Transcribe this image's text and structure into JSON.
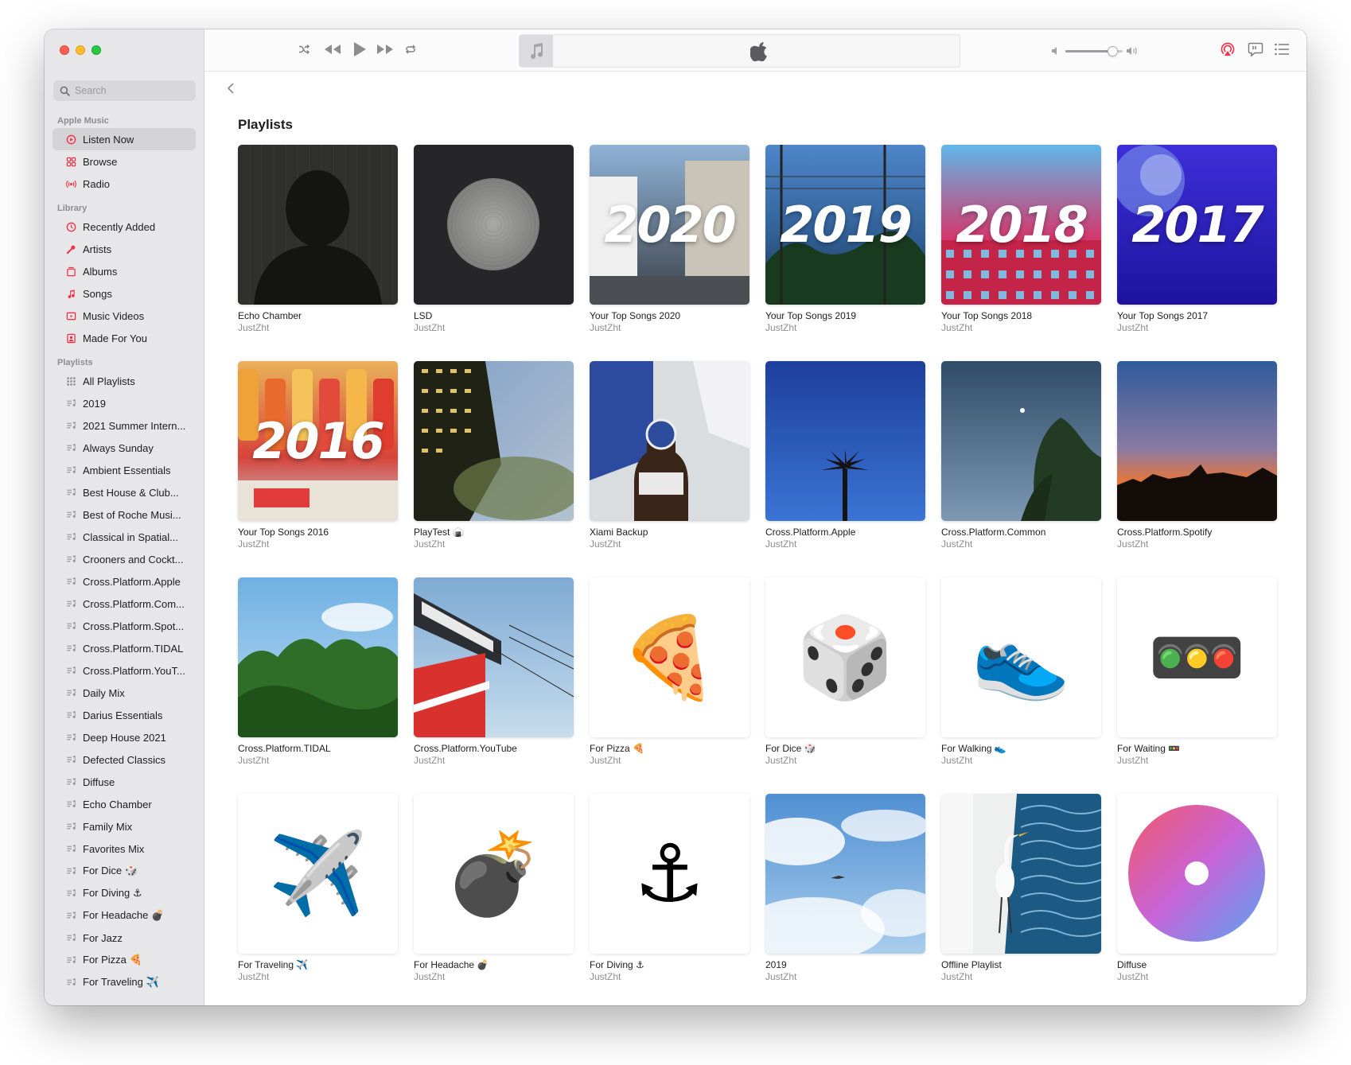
{
  "search": {
    "placeholder": "Search"
  },
  "sidebar": {
    "apple_music": {
      "title": "Apple Music",
      "items": [
        {
          "label": "Listen Now",
          "icon": "play-circle-icon",
          "active": true
        },
        {
          "label": "Browse",
          "icon": "grid-icon"
        },
        {
          "label": "Radio",
          "icon": "radio-icon"
        }
      ]
    },
    "library": {
      "title": "Library",
      "items": [
        {
          "label": "Recently Added",
          "icon": "clock-icon"
        },
        {
          "label": "Artists",
          "icon": "microphone-icon"
        },
        {
          "label": "Albums",
          "icon": "album-icon"
        },
        {
          "label": "Songs",
          "icon": "music-note-icon"
        },
        {
          "label": "Music Videos",
          "icon": "video-icon"
        },
        {
          "label": "Made For You",
          "icon": "person-icon"
        }
      ]
    },
    "playlists": {
      "title": "Playlists",
      "items": [
        "All Playlists",
        "2019",
        "2021 Summer Intern...",
        "Always Sunday",
        "Ambient Essentials",
        "Best House & Club...",
        "Best of Roche Musi...",
        "Classical in Spatial...",
        "Crooners and Cockt...",
        "Cross.Platform.Apple",
        "Cross.Platform.Com...",
        "Cross.Platform.Spot...",
        "Cross.Platform.TIDAL",
        "Cross.Platform.YouT...",
        "Daily Mix",
        "Darius Essentials",
        "Deep House 2021",
        "Defected Classics",
        "Diffuse",
        "Echo Chamber",
        "Family Mix",
        "Favorites Mix",
        "For Dice 🎲",
        "For Diving ⚓",
        "For Headache 💣",
        "For Jazz",
        "For Pizza 🍕",
        "For Traveling ✈️"
      ]
    }
  },
  "main": {
    "heading": "Playlists",
    "playlists": [
      {
        "title": "Echo Chamber",
        "owner": "JustZht",
        "art": "silhouette"
      },
      {
        "title": "LSD",
        "owner": "JustZht",
        "art": "disc"
      },
      {
        "title": "Your Top Songs 2020",
        "owner": "JustZht",
        "art": "year",
        "year": "2020"
      },
      {
        "title": "Your Top Songs 2019",
        "owner": "JustZht",
        "art": "year",
        "year": "2019"
      },
      {
        "title": "Your Top Songs 2018",
        "owner": "JustZht",
        "art": "year",
        "year": "2018"
      },
      {
        "title": "Your Top Songs 2017",
        "owner": "JustZht",
        "art": "year",
        "year": "2017"
      },
      {
        "title": "Your Top Songs 2016",
        "owner": "JustZht",
        "art": "year",
        "year": "2016"
      },
      {
        "title": "PlayTest 🍙",
        "owner": "JustZht",
        "art": "building"
      },
      {
        "title": "Xiami Backup",
        "owner": "JustZht",
        "art": "bottle"
      },
      {
        "title": "Cross.Platform.Apple",
        "owner": "JustZht",
        "art": "palm"
      },
      {
        "title": "Cross.Platform.Common",
        "owner": "JustZht",
        "art": "tree"
      },
      {
        "title": "Cross.Platform.Spotify",
        "owner": "JustZht",
        "art": "sunset"
      },
      {
        "title": "Cross.Platform.TIDAL",
        "owner": "JustZht",
        "art": "forest"
      },
      {
        "title": "Cross.Platform.YouTube",
        "owner": "JustZht",
        "art": "sign"
      },
      {
        "title": "For Pizza 🍕",
        "owner": "JustZht",
        "art": "emoji",
        "emoji": "🍕"
      },
      {
        "title": "For Dice 🎲",
        "owner": "JustZht",
        "art": "emoji",
        "emoji": "🎲"
      },
      {
        "title": "For Walking 👟",
        "owner": "JustZht",
        "art": "emoji",
        "emoji": "👟"
      },
      {
        "title": "For Waiting 🚥",
        "owner": "JustZht",
        "art": "emoji",
        "emoji": "🚥"
      },
      {
        "title": "For Traveling ✈️",
        "owner": "JustZht",
        "art": "emoji",
        "emoji": "✈️"
      },
      {
        "title": "For Headache 💣",
        "owner": "JustZht",
        "art": "emoji",
        "emoji": "💣"
      },
      {
        "title": "For Diving ⚓",
        "owner": "JustZht",
        "art": "emoji",
        "emoji": "⚓"
      },
      {
        "title": "2019",
        "owner": "JustZht",
        "art": "sky"
      },
      {
        "title": "Offline Playlist",
        "owner": "JustZht",
        "art": "heron"
      },
      {
        "title": "Diffuse",
        "owner": "JustZht",
        "art": "gradient"
      }
    ]
  },
  "player": {
    "volume_percent": 82
  },
  "colors": {
    "accent": "#fa2d48",
    "sidebar_bg": "#e7e6e8",
    "text": "#1d1d1f",
    "secondary_text": "#8e8e93"
  }
}
